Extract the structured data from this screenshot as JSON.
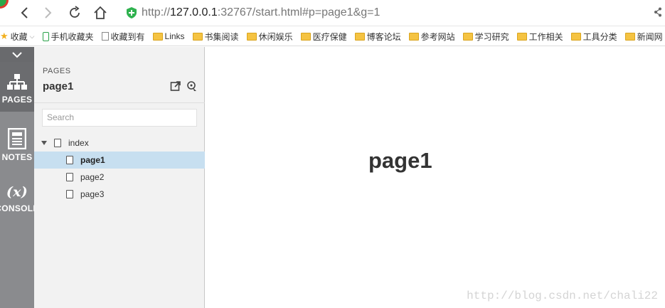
{
  "browser": {
    "url_prefix": "http://",
    "url_host": "127.0.0.1",
    "url_rest": ":32767/start.html#p=page1&g=1"
  },
  "bookmarks": [
    {
      "label": "收藏",
      "icon": "star-icon",
      "has_caret": true
    },
    {
      "label": "手机收藏夹",
      "icon": "phone-icon"
    },
    {
      "label": "收藏到有",
      "icon": "document-icon"
    },
    {
      "label": "Links",
      "icon": "folder-icon"
    },
    {
      "label": "书集阅读",
      "icon": "folder-icon"
    },
    {
      "label": "休闲娱乐",
      "icon": "folder-icon"
    },
    {
      "label": "医疗保健",
      "icon": "folder-icon"
    },
    {
      "label": "博客论坛",
      "icon": "folder-icon"
    },
    {
      "label": "参考网站",
      "icon": "folder-icon"
    },
    {
      "label": "学习研究",
      "icon": "folder-icon"
    },
    {
      "label": "工作相关",
      "icon": "folder-icon"
    },
    {
      "label": "工具分类",
      "icon": "folder-icon"
    },
    {
      "label": "新闻网",
      "icon": "folder-icon"
    }
  ],
  "sidebar": {
    "pages_label": "PAGES",
    "notes_label": "NOTES",
    "console_label": "CONSOLE",
    "console_symbol": "(x)"
  },
  "pages_panel": {
    "header": "PAGES",
    "current_page": "page1",
    "search_placeholder": "Search",
    "tree": {
      "root": "index",
      "children": [
        "page1",
        "page2",
        "page3"
      ],
      "selected": "page1"
    }
  },
  "main": {
    "title": "page1",
    "watermark": "http://blog.csdn.net/chali22"
  },
  "colors": {
    "sidebar_bg": "#8a8b8e",
    "selected_row": "#c7dff0",
    "panel_bg": "#f2f2f2"
  }
}
